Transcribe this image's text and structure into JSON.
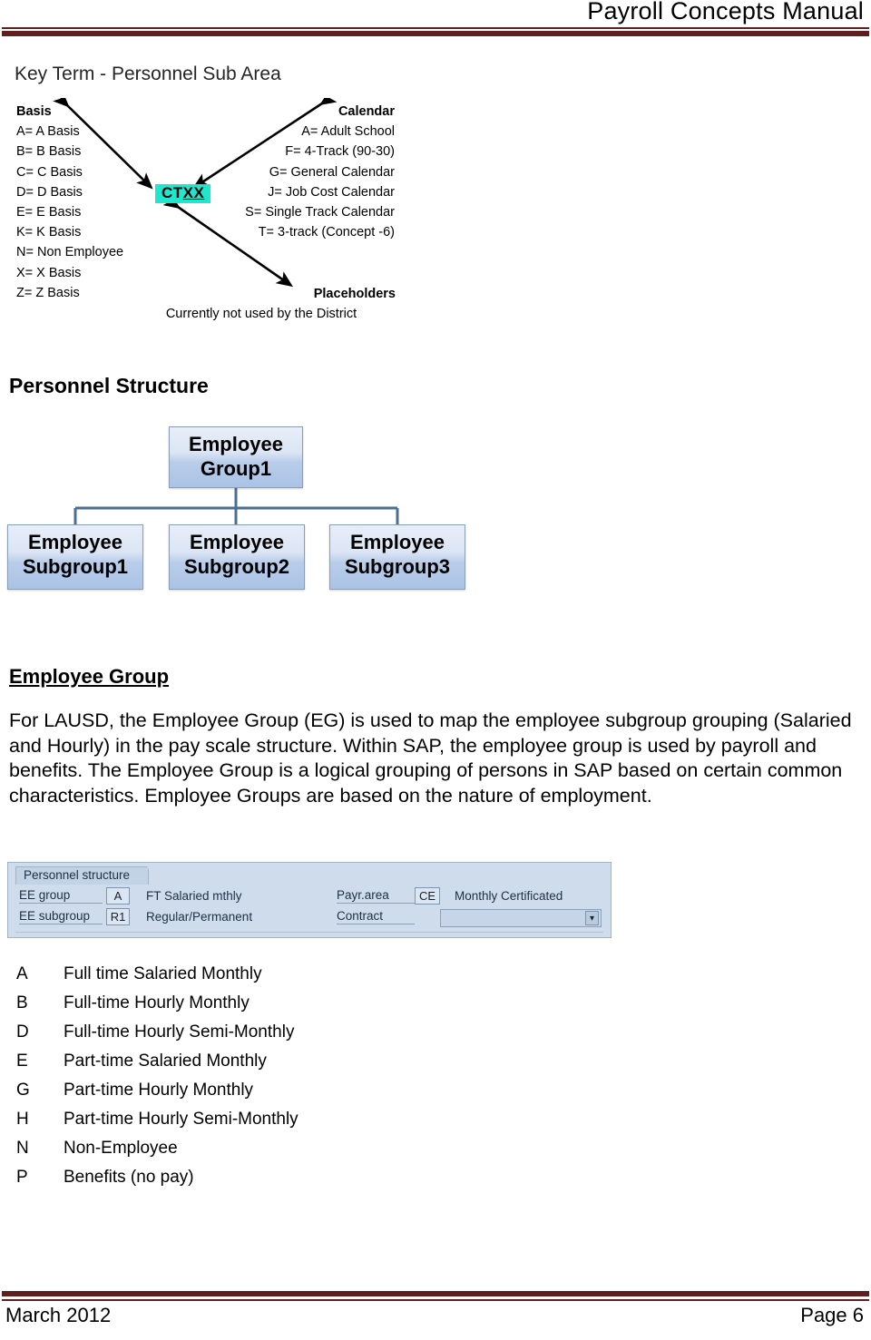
{
  "header": {
    "title": "Payroll Concepts Manual",
    "rule_color": "#5f1f1f"
  },
  "key_term": {
    "heading": "Key Term - Personnel Sub Area",
    "center_chip": {
      "prefix": "CT",
      "underlined": "XX",
      "highlight_color": "#1fe6cd"
    },
    "basis": {
      "title": "Basis",
      "items": [
        "A= A Basis",
        "B= B Basis",
        "C= C Basis",
        "D= D Basis",
        "E= E Basis",
        "K= K Basis",
        "N= Non Employee",
        "X= X Basis",
        "Z= Z Basis"
      ]
    },
    "calendar": {
      "title": "Calendar",
      "items": [
        "A= Adult School",
        "F= 4-Track (90-30)",
        "G= General Calendar",
        "J= Job Cost Calendar",
        "S= Single Track Calendar",
        "T= 3-track (Concept -6)"
      ]
    },
    "placeholders": {
      "title": "Placeholders",
      "note": "Currently not used by the District"
    }
  },
  "personnel_structure": {
    "heading": "Personnel Structure",
    "boxes": {
      "group1": "Employee\nGroup1",
      "group1_line1": "Employee",
      "group1_line2": "Group1",
      "sub1_line1": "Employee",
      "sub1_line2": "Subgroup1",
      "sub2_line1": "Employee",
      "sub2_line2": "Subgroup2",
      "sub3_line1": "Employee",
      "sub3_line2": "Subgroup3"
    },
    "connector_color": "#4a6f92"
  },
  "employee_group": {
    "heading": "Employee Group",
    "body": "For LAUSD, the Employee Group (EG) is used to map the employee subgroup grouping (Salaried and Hourly) in the pay scale structure. Within SAP, the employee group is used by payroll and benefits. The Employee Group is a logical grouping of persons in SAP based on certain common characteristics. Employee Groups are based on the nature of employment."
  },
  "sap_screen": {
    "tab_label": "Personnel structure",
    "fields": [
      {
        "label": "EE group",
        "key": "A",
        "text": "FT Salaried mthly"
      },
      {
        "label": "EE subgroup",
        "key": "R1",
        "text": "Regular/Permanent"
      },
      {
        "label": "Payr.area",
        "key": "CE",
        "text": "Monthly Certificated"
      },
      {
        "label": "Contract",
        "key": "",
        "text": ""
      }
    ],
    "contract_value": "",
    "dropdown_icon": "dropdown-icon"
  },
  "eg_codes": {
    "rows": [
      {
        "code": "A",
        "description": "Full time Salaried Monthly"
      },
      {
        "code": "B",
        "description": "Full-time Hourly Monthly"
      },
      {
        "code": "D",
        "description": "Full-time Hourly Semi-Monthly"
      },
      {
        "code": "E",
        "description": "Part-time Salaried Monthly"
      },
      {
        "code": "G",
        "description": "Part-time Hourly Monthly"
      },
      {
        "code": "H",
        "description": "Part-time Hourly Semi-Monthly"
      },
      {
        "code": "N",
        "description": "Non-Employee"
      },
      {
        "code": "P",
        "description": "Benefits (no pay)"
      }
    ]
  },
  "footer": {
    "date": "March 2012",
    "page": "Page 6"
  }
}
